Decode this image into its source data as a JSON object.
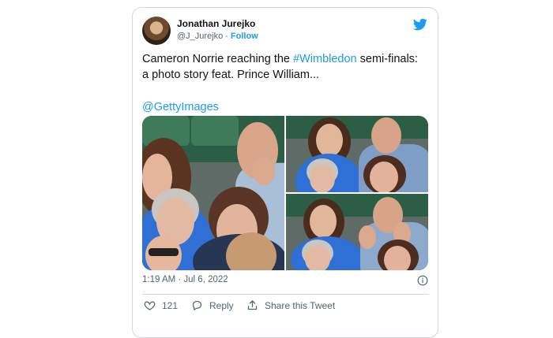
{
  "tweet": {
    "author": {
      "name": "Jonathan Jurejko",
      "handle": "@J_Jurejko",
      "follow_label": "Follow"
    },
    "text": {
      "part1": "Cameron Norrie reaching the ",
      "hashtag": "#Wimbledon",
      "part2": " semi-finals: a photo story feat. Prince William..."
    },
    "mention": "@GettyImages",
    "timestamp": "1:19 AM · Jul 6, 2022",
    "actions": {
      "likes": "121",
      "reply_label": "Reply",
      "share_label": "Share this Tweet"
    },
    "colors": {
      "accent": "#1d9bf0",
      "muted": "#536471",
      "like": "#536471"
    },
    "icons": [
      "twitter-bird-icon",
      "info-icon",
      "heart-icon",
      "reply-icon",
      "share-icon"
    ]
  }
}
